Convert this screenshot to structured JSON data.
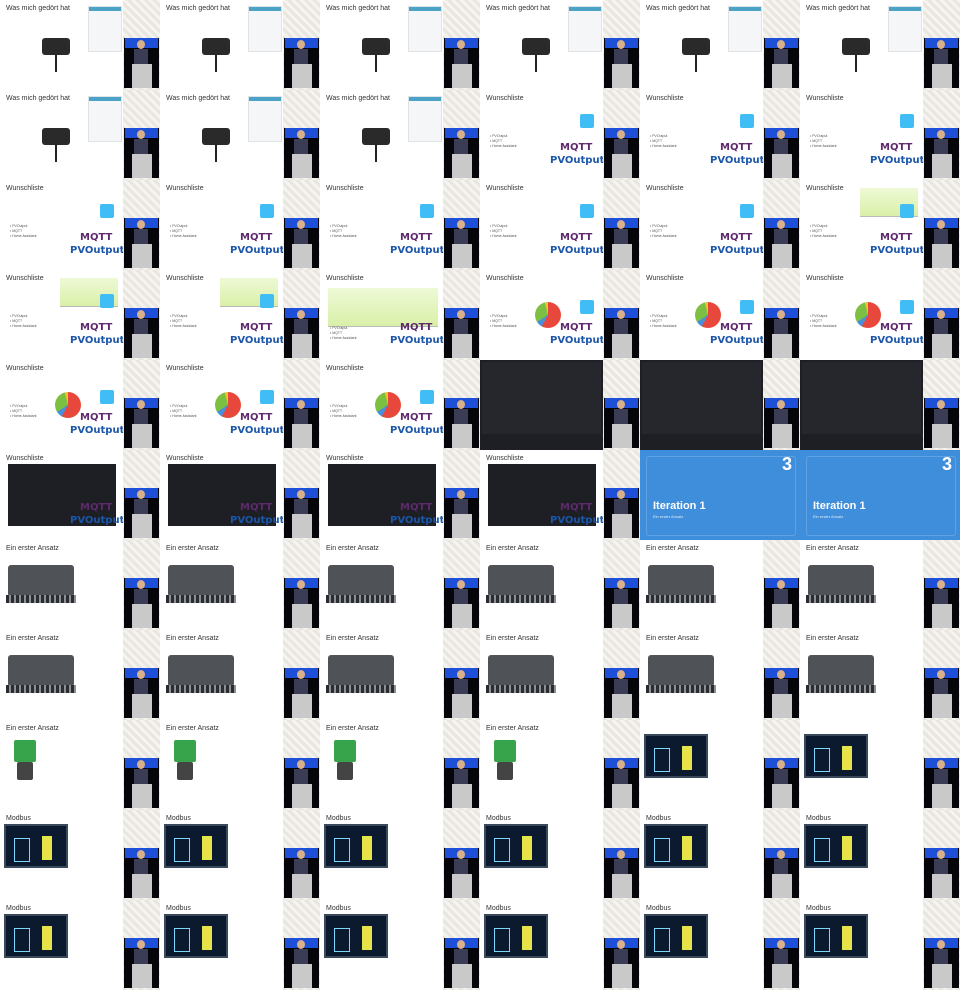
{
  "rows": [
    {
      "titles": [
        "Was mich gedört hat",
        "Was mich gedört hat",
        "Was mich gedört hat",
        "Was mich gedört hat",
        "Was mich gedört hat",
        "Was mich gedört hat"
      ]
    },
    {
      "titles": [
        "Was mich gedört hat",
        "Was mich gedört hat",
        "Was mich gedört hat",
        "Wunschliste",
        "Wunschliste",
        "Wunschliste"
      ]
    },
    {
      "titles": [
        "Wunschliste",
        "Wunschliste",
        "Wunschliste",
        "Wunschliste",
        "Wunschliste",
        "Wunschliste"
      ]
    },
    {
      "titles": [
        "Wunschliste",
        "Wunschliste",
        "Wunschliste",
        "Wunschliste",
        "Wunschliste",
        "Wunschliste"
      ]
    },
    {
      "titles": [
        "Wunschliste",
        "Wunschliste",
        "Wunschliste",
        "",
        "",
        ""
      ]
    },
    {
      "titles": [
        "Wunschliste",
        "Wunschliste",
        "Wunschliste",
        "Wunschliste",
        "",
        ""
      ]
    },
    {
      "titles": [
        "Ein erster Ansatz",
        "Ein erster Ansatz",
        "Ein erster Ansatz",
        "Ein erster Ansatz",
        "Ein erster Ansatz",
        "Ein erster Ansatz"
      ]
    },
    {
      "titles": [
        "Ein erster Ansatz",
        "Ein erster Ansatz",
        "Ein erster Ansatz",
        "Ein erster Ansatz",
        "Ein erster Ansatz",
        "Ein erster Ansatz"
      ]
    },
    {
      "titles": [
        "Ein erster Ansatz",
        "Ein erster Ansatz",
        "Ein erster Ansatz",
        "Ein erster Ansatz",
        "",
        ""
      ]
    },
    {
      "titles": [
        "Modbus",
        "Modbus",
        "Modbus",
        "Modbus",
        "Modbus",
        "Modbus"
      ]
    },
    {
      "titles": [
        "Modbus",
        "Modbus",
        "Modbus",
        "Modbus",
        "Modbus",
        "Modbus"
      ]
    }
  ],
  "wunsch_bullets": [
    "PVOutput",
    "MQTT",
    "Home Assistant"
  ],
  "logos": {
    "mqtt": "MQTT",
    "pvoutput": "PVOutput"
  },
  "iteration": {
    "number": "3",
    "title": "Iteration 1",
    "subtitle": "Ein erster Ansatz"
  },
  "colors": {
    "accent_blue": "#3f8edc",
    "ha_blue": "#41bdf5",
    "mqtt_purple": "#5e2a6d",
    "pv_blue": "#1c56a8"
  }
}
